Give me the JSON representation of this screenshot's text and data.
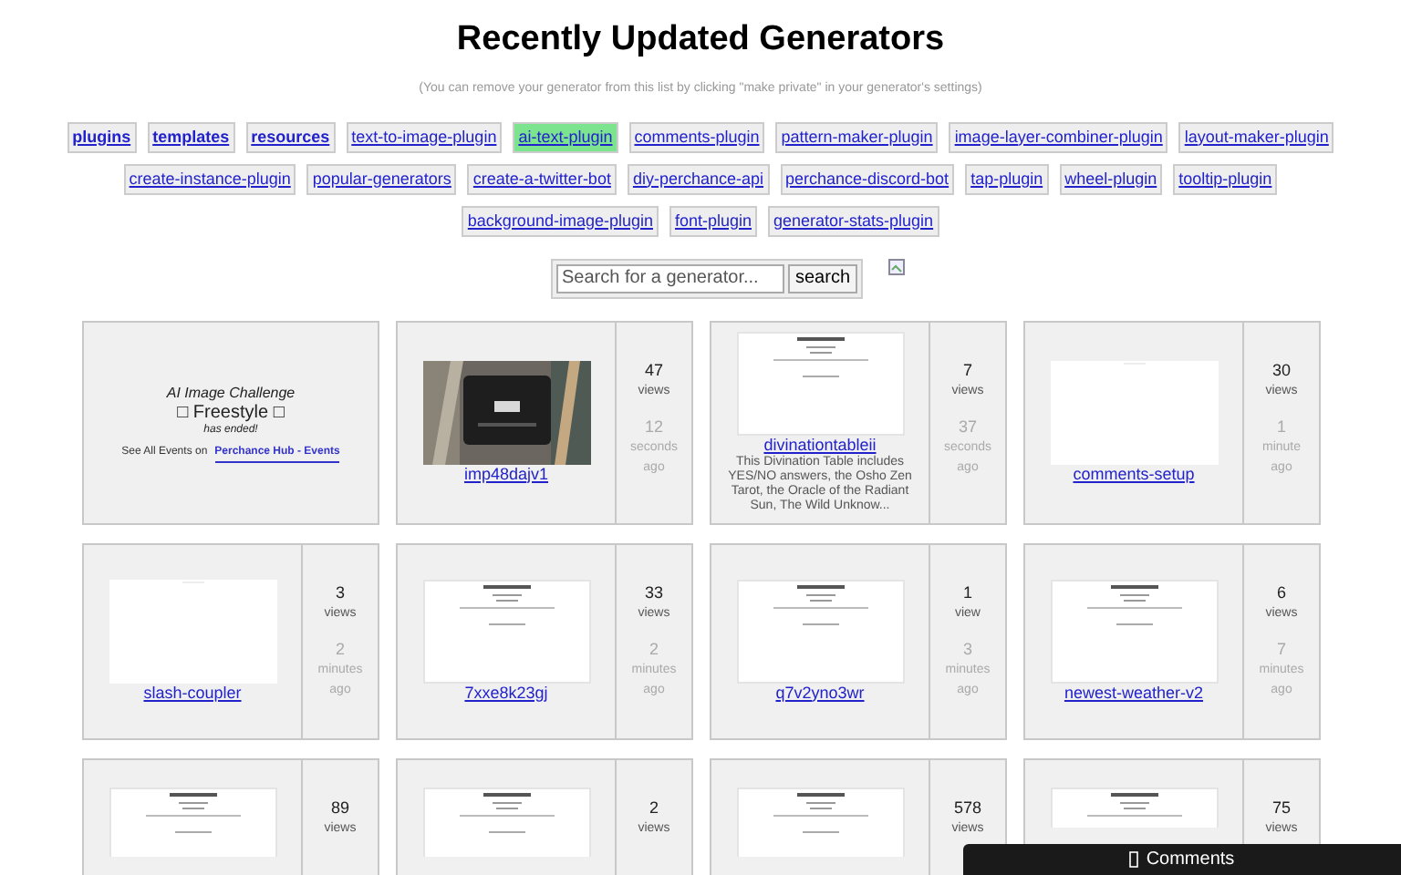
{
  "title": "Recently Updated Generators",
  "subtitle": "(You can remove your generator from this list by clicking \"make private\" in your generator's settings)",
  "links": [
    {
      "label": "plugins",
      "bold": true,
      "selected": false
    },
    {
      "label": "templates",
      "bold": true,
      "selected": false
    },
    {
      "label": "resources",
      "bold": true,
      "selected": false
    },
    {
      "label": "text-to-image-plugin",
      "bold": false,
      "selected": false
    },
    {
      "label": "ai-text-plugin",
      "bold": false,
      "selected": true
    },
    {
      "label": "comments-plugin",
      "bold": false,
      "selected": false
    },
    {
      "label": "pattern-maker-plugin",
      "bold": false,
      "selected": false
    },
    {
      "label": "image-layer-combiner-plugin",
      "bold": false,
      "selected": false
    },
    {
      "label": "layout-maker-plugin",
      "bold": false,
      "selected": false
    },
    {
      "label": "create-instance-plugin",
      "bold": false,
      "selected": false
    },
    {
      "label": "popular-generators",
      "bold": false,
      "selected": false
    },
    {
      "label": "create-a-twitter-bot",
      "bold": false,
      "selected": false
    },
    {
      "label": "diy-perchance-api",
      "bold": false,
      "selected": false
    },
    {
      "label": "perchance-discord-bot",
      "bold": false,
      "selected": false
    },
    {
      "label": "tap-plugin",
      "bold": false,
      "selected": false
    },
    {
      "label": "wheel-plugin",
      "bold": false,
      "selected": false
    },
    {
      "label": "tooltip-plugin",
      "bold": false,
      "selected": false
    },
    {
      "label": "background-image-plugin",
      "bold": false,
      "selected": false
    },
    {
      "label": "font-plugin",
      "bold": false,
      "selected": false
    },
    {
      "label": "generator-stats-plugin",
      "bold": false,
      "selected": false
    }
  ],
  "search": {
    "placeholder": "Search for a generator...",
    "button": "search"
  },
  "cards": [
    {
      "kind": "event",
      "line1": "AI Image Challenge",
      "line2": "□ Freestyle □",
      "line3": "has ended!",
      "line4": "See All Events on",
      "link": "Perchance Hub - Events"
    },
    {
      "kind": "generator",
      "name": "imp48dajv1",
      "views": "47",
      "views_label": "views",
      "age": "12",
      "age_unit": "seconds",
      "age_suffix": "ago"
    },
    {
      "kind": "generator",
      "name": "divinationtableii",
      "description": "This Divination Table includes YES/NO answers, the Osho Zen Tarot, the Oracle of the Radiant Sun, The Wild Unknow...",
      "views": "7",
      "views_label": "views",
      "age": "37",
      "age_unit": "seconds",
      "age_suffix": "ago"
    },
    {
      "kind": "generator",
      "name": "comments-setup",
      "views": "30",
      "views_label": "views",
      "age": "1",
      "age_unit": "minute",
      "age_suffix": "ago"
    },
    {
      "kind": "generator",
      "name": "slash-coupler",
      "views": "3",
      "views_label": "views",
      "age": "2",
      "age_unit": "minutes",
      "age_suffix": "ago"
    },
    {
      "kind": "generator",
      "name": "7xxe8k23gj",
      "views": "33",
      "views_label": "views",
      "age": "2",
      "age_unit": "minutes",
      "age_suffix": "ago"
    },
    {
      "kind": "generator",
      "name": "q7v2yno3wr",
      "views": "1",
      "views_label": "view",
      "age": "3",
      "age_unit": "minutes",
      "age_suffix": "ago"
    },
    {
      "kind": "generator",
      "name": "newest-weather-v2",
      "views": "6",
      "views_label": "views",
      "age": "7",
      "age_unit": "minutes",
      "age_suffix": "ago"
    },
    {
      "kind": "generator",
      "views": "89",
      "views_label": "views"
    },
    {
      "kind": "generator",
      "views": "2",
      "views_label": "views"
    },
    {
      "kind": "generator",
      "views": "578",
      "views_label": "views"
    },
    {
      "kind": "generator",
      "views": "75",
      "views_label": "views"
    }
  ],
  "comments_bar": {
    "label": "Comments"
  }
}
